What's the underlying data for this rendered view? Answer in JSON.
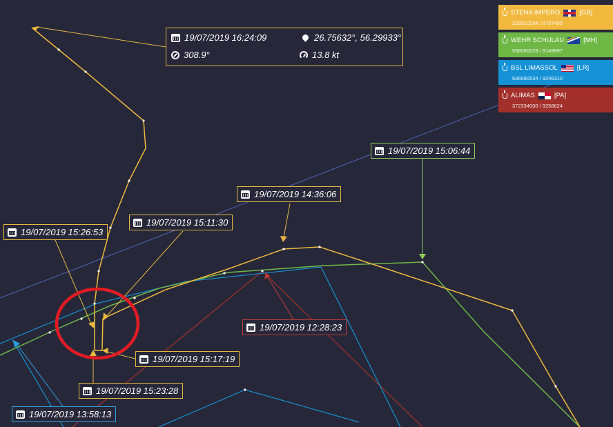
{
  "colors": {
    "stena_impero": "#f2b93f",
    "wehr_schulau": "#6fb846",
    "bsl_limassol": "#1592d6",
    "alimas": "#a3302a",
    "background": "#262839",
    "highlight_circle": "#e31b23"
  },
  "info_box": {
    "datetime": "19/07/2019 16:24:09",
    "position": "26.75632°, 56.29933°",
    "course": "308.9°",
    "speed": "13.8 kt",
    "icons": [
      "calendar-icon",
      "location-pin-icon",
      "compass-icon",
      "speedometer-icon"
    ]
  },
  "legend": [
    {
      "name": "STENA IMPERO",
      "flag": "GB",
      "flag_label": "[GB]",
      "ids": "232010294 / 9797400",
      "color": "#f2b93f"
    },
    {
      "name": "WEHR SCHULAU",
      "flag": "MH",
      "flag_label": "[MH]",
      "ids": "538090029 / 9149897",
      "color": "#6fb846"
    },
    {
      "name": "BSL LIMASSOL",
      "flag": "LR",
      "flag_label": "[LR]",
      "ids": "636090534 / 9246310",
      "color": "#1592d6"
    },
    {
      "name": "ALIMAS",
      "flag": "PA",
      "flag_label": "[PA]",
      "ids": "372334000 / 9258624",
      "color": "#a3302a"
    }
  ],
  "timestamps": {
    "t_150644": "19/07/2019 15:06:44",
    "t_143606": "19/07/2019 14:36:06",
    "t_151130": "19/07/2019 15:11:30",
    "t_152653": "19/07/2019 15:26:53",
    "t_122823": "19/07/2019 12:28:23",
    "t_151719": "19/07/2019 15:17:19",
    "t_152328": "19/07/2019 15:23:28",
    "t_135813": "19/07/2019 13:58:13"
  }
}
